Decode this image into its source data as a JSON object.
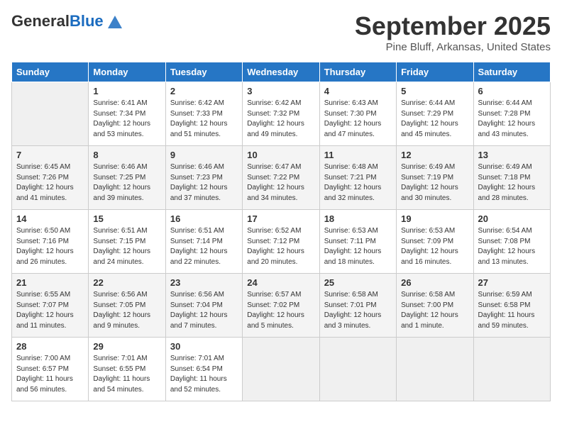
{
  "logo": {
    "general": "General",
    "blue": "Blue"
  },
  "title": "September 2025",
  "location": "Pine Bluff, Arkansas, United States",
  "days_of_week": [
    "Sunday",
    "Monday",
    "Tuesday",
    "Wednesday",
    "Thursday",
    "Friday",
    "Saturday"
  ],
  "weeks": [
    [
      {
        "num": "",
        "info": ""
      },
      {
        "num": "1",
        "info": "Sunrise: 6:41 AM\nSunset: 7:34 PM\nDaylight: 12 hours\nand 53 minutes."
      },
      {
        "num": "2",
        "info": "Sunrise: 6:42 AM\nSunset: 7:33 PM\nDaylight: 12 hours\nand 51 minutes."
      },
      {
        "num": "3",
        "info": "Sunrise: 6:42 AM\nSunset: 7:32 PM\nDaylight: 12 hours\nand 49 minutes."
      },
      {
        "num": "4",
        "info": "Sunrise: 6:43 AM\nSunset: 7:30 PM\nDaylight: 12 hours\nand 47 minutes."
      },
      {
        "num": "5",
        "info": "Sunrise: 6:44 AM\nSunset: 7:29 PM\nDaylight: 12 hours\nand 45 minutes."
      },
      {
        "num": "6",
        "info": "Sunrise: 6:44 AM\nSunset: 7:28 PM\nDaylight: 12 hours\nand 43 minutes."
      }
    ],
    [
      {
        "num": "7",
        "info": "Sunrise: 6:45 AM\nSunset: 7:26 PM\nDaylight: 12 hours\nand 41 minutes."
      },
      {
        "num": "8",
        "info": "Sunrise: 6:46 AM\nSunset: 7:25 PM\nDaylight: 12 hours\nand 39 minutes."
      },
      {
        "num": "9",
        "info": "Sunrise: 6:46 AM\nSunset: 7:23 PM\nDaylight: 12 hours\nand 37 minutes."
      },
      {
        "num": "10",
        "info": "Sunrise: 6:47 AM\nSunset: 7:22 PM\nDaylight: 12 hours\nand 34 minutes."
      },
      {
        "num": "11",
        "info": "Sunrise: 6:48 AM\nSunset: 7:21 PM\nDaylight: 12 hours\nand 32 minutes."
      },
      {
        "num": "12",
        "info": "Sunrise: 6:49 AM\nSunset: 7:19 PM\nDaylight: 12 hours\nand 30 minutes."
      },
      {
        "num": "13",
        "info": "Sunrise: 6:49 AM\nSunset: 7:18 PM\nDaylight: 12 hours\nand 28 minutes."
      }
    ],
    [
      {
        "num": "14",
        "info": "Sunrise: 6:50 AM\nSunset: 7:16 PM\nDaylight: 12 hours\nand 26 minutes."
      },
      {
        "num": "15",
        "info": "Sunrise: 6:51 AM\nSunset: 7:15 PM\nDaylight: 12 hours\nand 24 minutes."
      },
      {
        "num": "16",
        "info": "Sunrise: 6:51 AM\nSunset: 7:14 PM\nDaylight: 12 hours\nand 22 minutes."
      },
      {
        "num": "17",
        "info": "Sunrise: 6:52 AM\nSunset: 7:12 PM\nDaylight: 12 hours\nand 20 minutes."
      },
      {
        "num": "18",
        "info": "Sunrise: 6:53 AM\nSunset: 7:11 PM\nDaylight: 12 hours\nand 18 minutes."
      },
      {
        "num": "19",
        "info": "Sunrise: 6:53 AM\nSunset: 7:09 PM\nDaylight: 12 hours\nand 16 minutes."
      },
      {
        "num": "20",
        "info": "Sunrise: 6:54 AM\nSunset: 7:08 PM\nDaylight: 12 hours\nand 13 minutes."
      }
    ],
    [
      {
        "num": "21",
        "info": "Sunrise: 6:55 AM\nSunset: 7:07 PM\nDaylight: 12 hours\nand 11 minutes."
      },
      {
        "num": "22",
        "info": "Sunrise: 6:56 AM\nSunset: 7:05 PM\nDaylight: 12 hours\nand 9 minutes."
      },
      {
        "num": "23",
        "info": "Sunrise: 6:56 AM\nSunset: 7:04 PM\nDaylight: 12 hours\nand 7 minutes."
      },
      {
        "num": "24",
        "info": "Sunrise: 6:57 AM\nSunset: 7:02 PM\nDaylight: 12 hours\nand 5 minutes."
      },
      {
        "num": "25",
        "info": "Sunrise: 6:58 AM\nSunset: 7:01 PM\nDaylight: 12 hours\nand 3 minutes."
      },
      {
        "num": "26",
        "info": "Sunrise: 6:58 AM\nSunset: 7:00 PM\nDaylight: 12 hours\nand 1 minute."
      },
      {
        "num": "27",
        "info": "Sunrise: 6:59 AM\nSunset: 6:58 PM\nDaylight: 11 hours\nand 59 minutes."
      }
    ],
    [
      {
        "num": "28",
        "info": "Sunrise: 7:00 AM\nSunset: 6:57 PM\nDaylight: 11 hours\nand 56 minutes."
      },
      {
        "num": "29",
        "info": "Sunrise: 7:01 AM\nSunset: 6:55 PM\nDaylight: 11 hours\nand 54 minutes."
      },
      {
        "num": "30",
        "info": "Sunrise: 7:01 AM\nSunset: 6:54 PM\nDaylight: 11 hours\nand 52 minutes."
      },
      {
        "num": "",
        "info": ""
      },
      {
        "num": "",
        "info": ""
      },
      {
        "num": "",
        "info": ""
      },
      {
        "num": "",
        "info": ""
      }
    ]
  ]
}
